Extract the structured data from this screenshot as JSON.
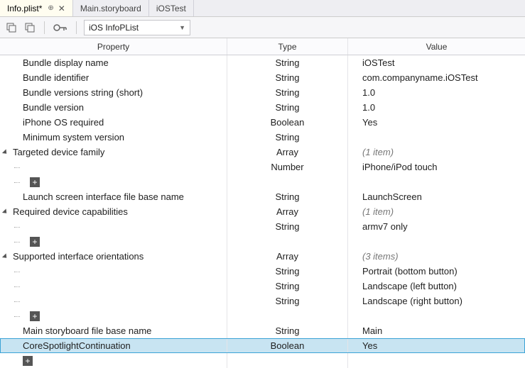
{
  "tabs": [
    {
      "label": "Info.plist*",
      "active": true,
      "pinned": true,
      "closeable": true
    },
    {
      "label": "Main.storyboard",
      "active": false
    },
    {
      "label": "iOSTest",
      "active": false
    }
  ],
  "type_dropdown": {
    "selected": "iOS InfoPList"
  },
  "columns": {
    "property": "Property",
    "type": "Type",
    "value": "Value"
  },
  "rows": [
    {
      "kind": "leaf",
      "depth": 0,
      "property": "Bundle display name",
      "type": "String",
      "value": "iOSTest"
    },
    {
      "kind": "leaf",
      "depth": 0,
      "property": "Bundle identifier",
      "type": "String",
      "value": "com.companyname.iOSTest"
    },
    {
      "kind": "leaf",
      "depth": 0,
      "property": "Bundle versions string (short)",
      "type": "String",
      "value": "1.0"
    },
    {
      "kind": "leaf",
      "depth": 0,
      "property": "Bundle version",
      "type": "String",
      "value": "1.0"
    },
    {
      "kind": "leaf",
      "depth": 0,
      "property": "iPhone OS required",
      "type": "Boolean",
      "value": "Yes"
    },
    {
      "kind": "leaf",
      "depth": 0,
      "property": "Minimum system version",
      "type": "String",
      "value": ""
    },
    {
      "kind": "group",
      "depth": 0,
      "property": "Targeted device family",
      "type": "Array",
      "value": "(1 item)",
      "italic": true
    },
    {
      "kind": "child",
      "depth": 1,
      "property": "",
      "type": "Number",
      "value": "iPhone/iPod touch"
    },
    {
      "kind": "add",
      "depth": 1
    },
    {
      "kind": "leaf",
      "depth": 0,
      "property": "Launch screen interface file base name",
      "type": "String",
      "value": "LaunchScreen"
    },
    {
      "kind": "group",
      "depth": 0,
      "property": "Required device capabilities",
      "type": "Array",
      "value": "(1 item)",
      "italic": true
    },
    {
      "kind": "child",
      "depth": 1,
      "property": "",
      "type": "String",
      "value": "armv7 only"
    },
    {
      "kind": "add",
      "depth": 1
    },
    {
      "kind": "group",
      "depth": 0,
      "property": "Supported interface orientations",
      "type": "Array",
      "value": "(3 items)",
      "italic": true
    },
    {
      "kind": "child",
      "depth": 1,
      "property": "",
      "type": "String",
      "value": "Portrait (bottom button)"
    },
    {
      "kind": "child",
      "depth": 1,
      "property": "",
      "type": "String",
      "value": "Landscape (left button)"
    },
    {
      "kind": "child",
      "depth": 1,
      "property": "",
      "type": "String",
      "value": "Landscape (right button)"
    },
    {
      "kind": "add",
      "depth": 1
    },
    {
      "kind": "leaf",
      "depth": 0,
      "property": "Main storyboard file base name",
      "type": "String",
      "value": "Main"
    },
    {
      "kind": "leaf",
      "depth": 0,
      "property": "CoreSpotlightContinuation",
      "type": "Boolean",
      "value": "Yes",
      "selected": true
    },
    {
      "kind": "add",
      "depth": 0
    }
  ]
}
